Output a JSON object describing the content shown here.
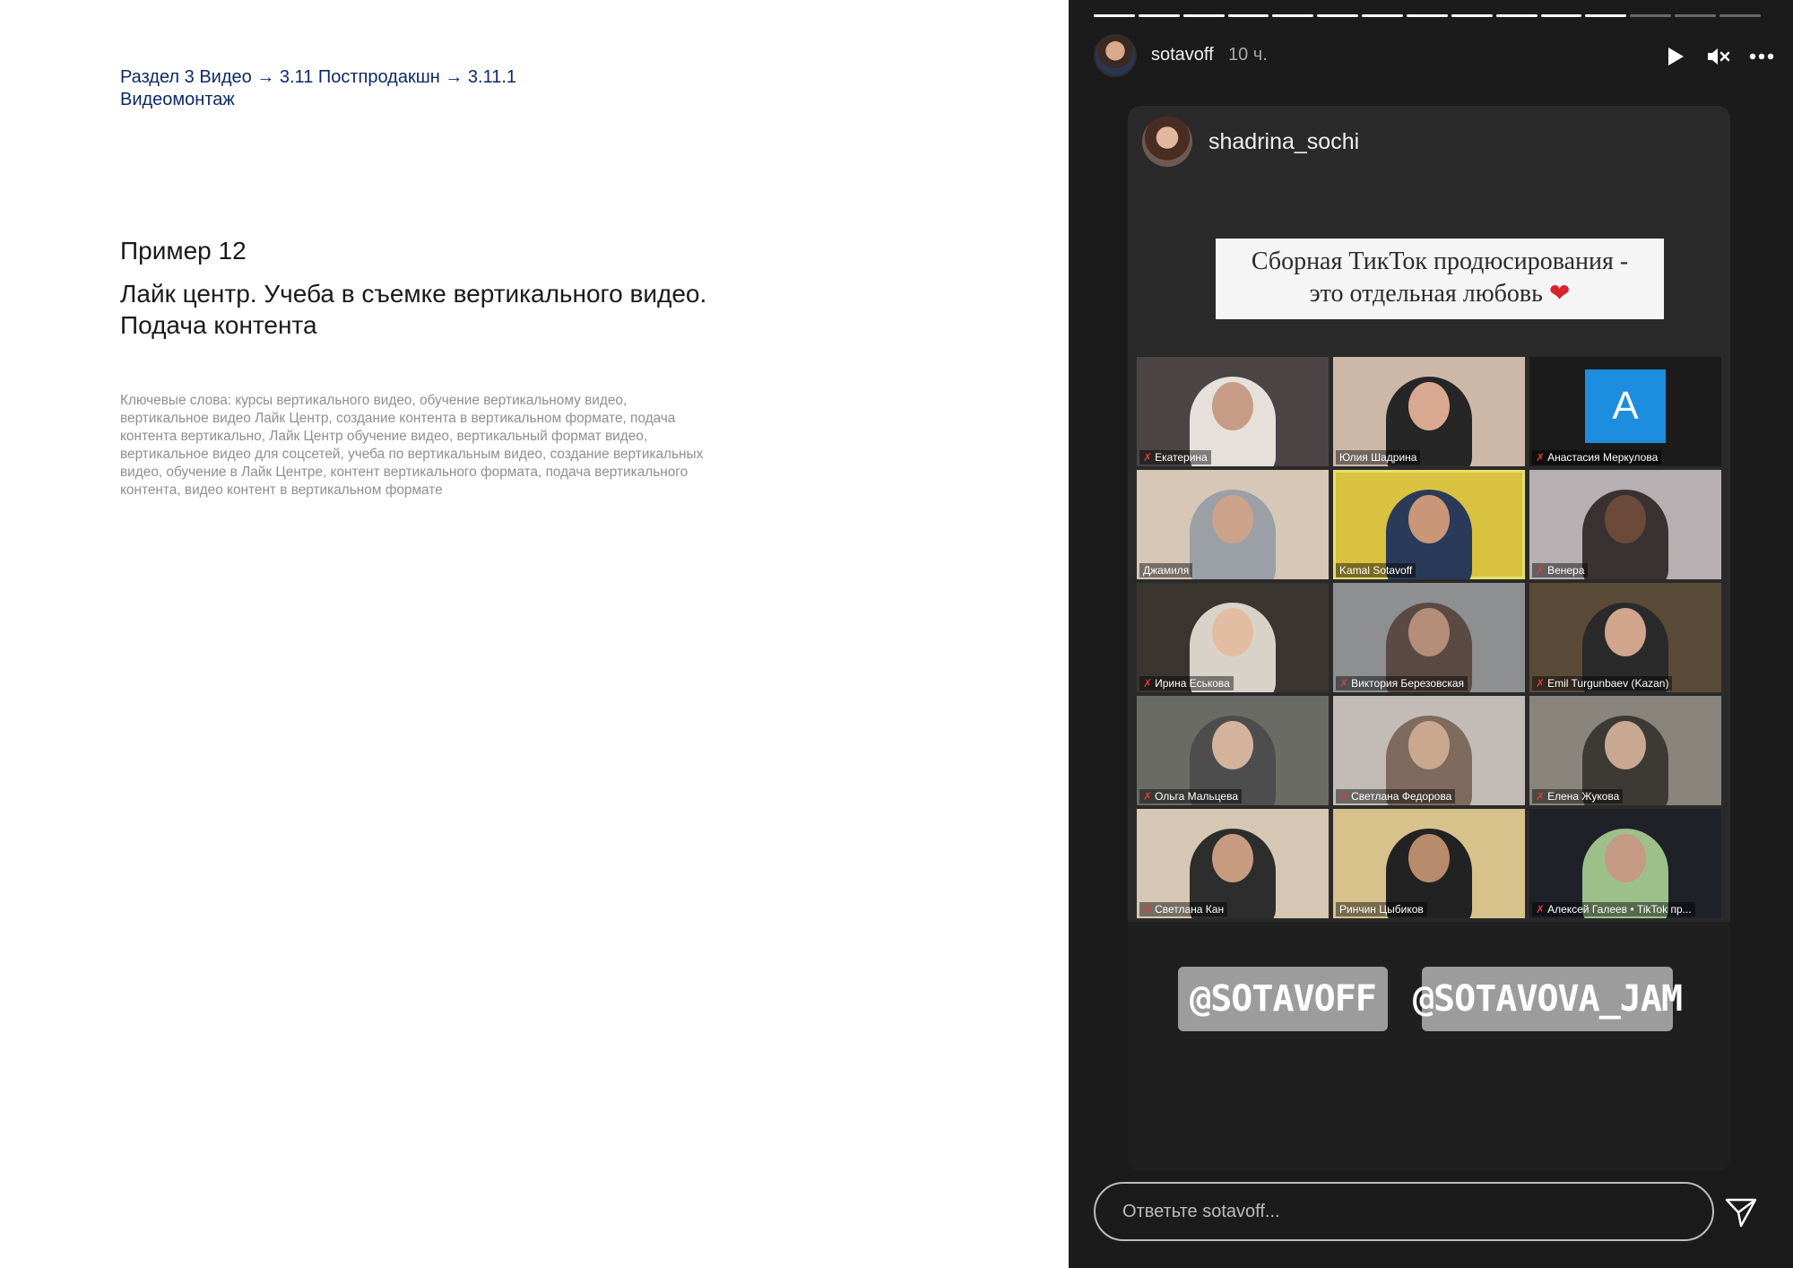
{
  "breadcrumb": "Раздел 3 Видео → 3.11 Постпродакшн → 3.11.1 Видеомонтаж",
  "example": {
    "number": "Пример 12",
    "title": "Лайк центр. Учеба в съемке вертикального видео. Подача контента",
    "keywords": "Ключевые слова: курсы вертикального видео, обучение вертикальному видео, вертикальное видео Лайк Центр, создание контента в вертикальном формате, подача контента вертикально, Лайк Центр обучение видео, вертикальный формат видео, вертикальное видео для соцсетей, учеба по вертикальным видео, создание вертикальных видео, обучение в Лайк Центре, контент вертикального формата, подача вертикального контента, видео контент в вертикальном формате"
  },
  "story": {
    "progress": {
      "total": 15,
      "completed": 12
    },
    "header": {
      "username": "sotavoff",
      "time": "10 ч.",
      "icons": [
        "play-icon",
        "mute-icon",
        "more-icon"
      ]
    },
    "source_username": "shadrina_sochi",
    "caption": {
      "line1": "Сборная ТикТок продюсирования -",
      "line2": "это отдельная любовь",
      "emoji": "❤"
    },
    "participants": [
      {
        "name": "Екатерина",
        "muted": true,
        "bg": "#4c4444",
        "skin": "#c79c86",
        "shirt": "#e6e0da"
      },
      {
        "name": "Юлия Шадрина",
        "muted": false,
        "bg": "#cdb8a8",
        "skin": "#d8a990",
        "shirt": "#262626"
      },
      {
        "name": "Анастасия Меркулова",
        "muted": true,
        "avatar_letter": "A",
        "bg": "#1b1b1b"
      },
      {
        "name": "Джамиля",
        "muted": false,
        "bg": "#d7c7b7",
        "skin": "#caa38a",
        "shirt": "#9aa0a6"
      },
      {
        "name": "Kamal Sotavoff",
        "muted": false,
        "active": true,
        "bg": "#d9c23f",
        "skin": "#c99677",
        "shirt": "#2a3b5a"
      },
      {
        "name": "Венера",
        "muted": true,
        "bg": "#b7b0b2",
        "skin": "#6b4a3a",
        "shirt": "#3a3232"
      },
      {
        "name": "Ирина Еськова",
        "muted": true,
        "bg": "#3b3530",
        "skin": "#e2bda2",
        "shirt": "#d9d2c8"
      },
      {
        "name": "Виктория Березовская",
        "muted": true,
        "bg": "#8d8f91",
        "skin": "#b48e78",
        "shirt": "#5b4a44"
      },
      {
        "name": "Emil Turgunbaev (Kazan)",
        "muted": true,
        "bg": "#5a4a38",
        "skin": "#d0a58c",
        "shirt": "#2a2a2a"
      },
      {
        "name": "Ольга Мальцева",
        "muted": true,
        "bg": "#6b6b66",
        "skin": "#d3b39b",
        "shirt": "#4d4d4d"
      },
      {
        "name": "Светлана Федорова",
        "muted": true,
        "bg": "#c3bcb6",
        "skin": "#caa88f",
        "shirt": "#7f6a5e"
      },
      {
        "name": "Елена Жукова",
        "muted": true,
        "bg": "#8a857c",
        "skin": "#c9a892",
        "shirt": "#3d3a36"
      },
      {
        "name": "Светлана Кан",
        "muted": true,
        "bg": "#d6c7b4",
        "skin": "#c79b80",
        "shirt": "#2d2d2d"
      },
      {
        "name": "Ринчин Цыбиков",
        "muted": false,
        "bg": "#d6c28a",
        "skin": "#b88b6c",
        "shirt": "#222222"
      },
      {
        "name": "Алексей Галеев • TikTok пр...",
        "muted": true,
        "bg": "#1e2228",
        "skin": "#c49a84",
        "shirt": "#9dc08b"
      }
    ],
    "tags": [
      "@SOTAVOFF",
      "@SOTAVOVA_JAM"
    ],
    "reply_placeholder": "Ответьте sotavoff...",
    "send_icon": "send-icon"
  }
}
